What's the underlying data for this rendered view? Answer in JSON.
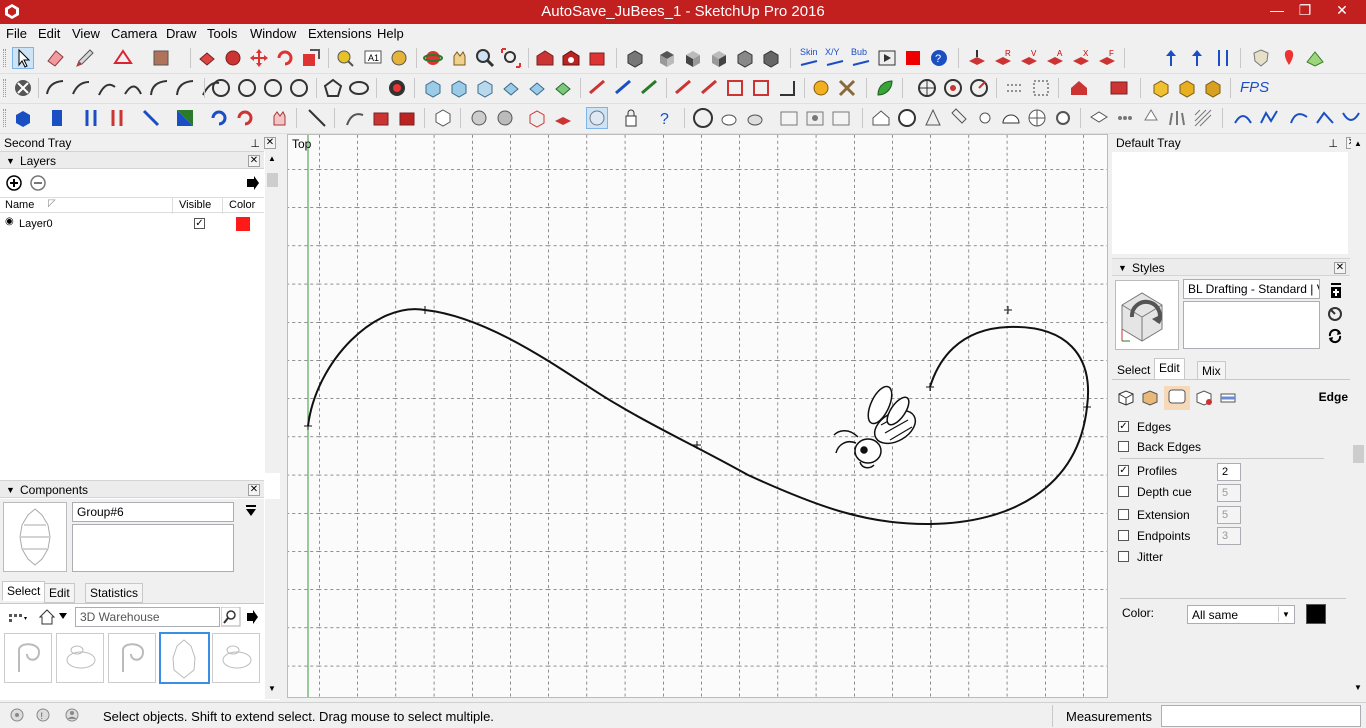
{
  "window": {
    "title": "AutoSave_JuBees_1 - SketchUp Pro 2016",
    "minimize": "—",
    "maximize": "❐",
    "close": "✕"
  },
  "menu": [
    "File",
    "Edit",
    "View",
    "Camera",
    "Draw",
    "Tools",
    "Window",
    "Extensions",
    "Help"
  ],
  "toolbar_icons": {
    "row1": [
      "select-icon",
      "eraser-icon",
      "pencil-icon",
      "shape-icon",
      "paint-bucket-icon",
      "push-pull-icon",
      "follow-me-icon",
      "move-icon",
      "rotate-icon",
      "scale-icon",
      "tape-measure-icon",
      "text-icon",
      "paint-icon",
      "orbit-icon",
      "pan-icon",
      "zoom-icon",
      "zoom-extents-icon",
      "warehouse-icon",
      "extension-warehouse-icon",
      "component-icon",
      "view-iso-icon",
      "view-top-icon",
      "view-front-icon",
      "view-right-icon",
      "view-back-icon",
      "view-left-icon",
      "skin-icon",
      "xy-icon",
      "bub-icon",
      "record-icon",
      "stop-icon",
      "help-icon",
      "sandbox-icon"
    ],
    "skin_label": "Skin",
    "xy_label": "X/Y",
    "bub_label": "Bub",
    "fps_label": "FPS"
  },
  "left_tray": {
    "title": "Second Tray",
    "layers": {
      "title": "Layers",
      "columns": [
        "Name",
        "Visible",
        "Color"
      ],
      "rows": [
        {
          "name": "Layer0",
          "visible": true,
          "color": "#ff1a1a"
        }
      ]
    },
    "components": {
      "title": "Components",
      "name_value": "Group#6",
      "tabs": [
        "Select",
        "Edit",
        "Statistics"
      ],
      "search_placeholder": "3D Warehouse"
    }
  },
  "viewport": {
    "view_label": "Top"
  },
  "right_tray": {
    "title": "Default Tray",
    "styles": {
      "title": "Styles",
      "style_name": "BL Drafting - Standard | VP",
      "tabs": [
        "Select",
        "Edit",
        "Mix"
      ],
      "section_label": "Edge",
      "options": [
        {
          "label": "Edges",
          "checked": true,
          "value": ""
        },
        {
          "label": "Back Edges",
          "checked": false,
          "value": ""
        },
        {
          "label": "Profiles",
          "checked": true,
          "value": "2"
        },
        {
          "label": "Depth cue",
          "checked": false,
          "value": "5"
        },
        {
          "label": "Extension",
          "checked": false,
          "value": "5"
        },
        {
          "label": "Endpoints",
          "checked": false,
          "value": "3"
        },
        {
          "label": "Jitter",
          "checked": false,
          "value": ""
        }
      ],
      "color_label": "Color:",
      "color_select": "All same",
      "color_swatch": "#000000"
    }
  },
  "status": {
    "message": "Select objects. Shift to extend select. Drag mouse to select multiple.",
    "measurements_label": "Measurements",
    "measurements_value": ""
  }
}
